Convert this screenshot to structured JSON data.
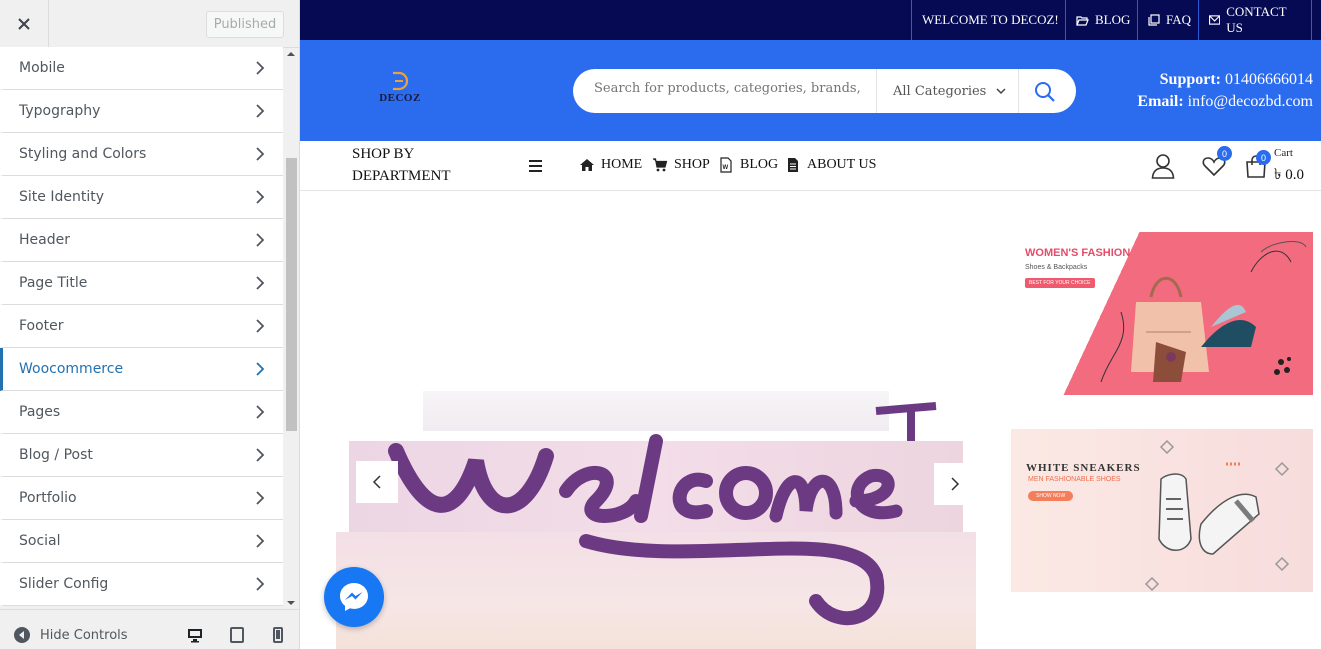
{
  "customizer": {
    "publish_label": "Published",
    "menu_items": [
      {
        "label": "Mobile"
      },
      {
        "label": "Typography"
      },
      {
        "label": "Styling and Colors"
      },
      {
        "label": "Site Identity"
      },
      {
        "label": "Header"
      },
      {
        "label": "Page Title"
      },
      {
        "label": "Footer"
      },
      {
        "label": "Woocommerce",
        "active": true
      },
      {
        "label": "Pages"
      },
      {
        "label": "Blog / Post"
      },
      {
        "label": "Portfolio"
      },
      {
        "label": "Social"
      },
      {
        "label": "Slider Config"
      }
    ],
    "hide_controls_label": "Hide Controls",
    "accent_color": "#2271b1"
  },
  "site": {
    "topbar": {
      "welcome": "WELCOME TO DECOZ!",
      "blog": "BLOG",
      "faq": "FAQ",
      "contact": "CONTACT US",
      "bg_color": "#050a52"
    },
    "header": {
      "logo_text": "DECOZ",
      "search_placeholder": "Search for products, categories, brands, s",
      "category_select": "All Categories",
      "support_label": "Support:",
      "support_phone": "01406666014",
      "email_label": "Email:",
      "email": "info@decozbd.com",
      "bg_color": "#2b6bed"
    },
    "nav": {
      "department_label": "SHOP BY DEPARTMENT",
      "links": [
        "HOME",
        "SHOP",
        "BLOG",
        "ABOUT US"
      ],
      "wishlist_count": "0",
      "cart_count": "0",
      "cart_label": "Cart",
      "cart_total": "৳ 0.0"
    },
    "slider": {
      "text": "Welcome"
    },
    "banners": [
      {
        "title": "WOMEN'S FASHION",
        "subtitle": "Shoes & Backpacks",
        "cta": "BEST FOR YOUR CHOICE"
      },
      {
        "title": "WHITE SNEAKERS",
        "subtitle": "MEN FASHIONABLE SHOES",
        "cta": "SHOW NOW"
      }
    ]
  }
}
